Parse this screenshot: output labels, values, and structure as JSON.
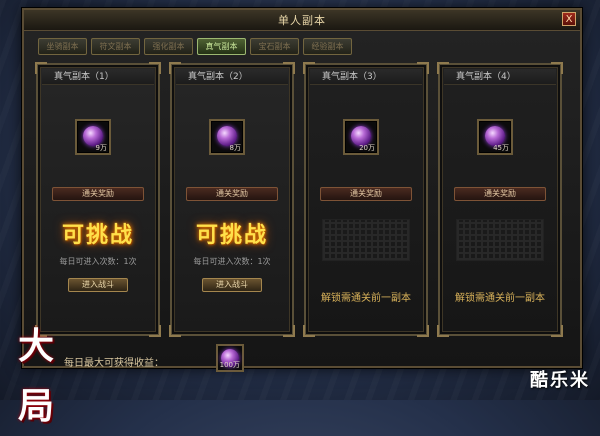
{
  "window": {
    "title": "单人副本",
    "close_label": "X"
  },
  "tabs": [
    {
      "label": "坐骑副本",
      "active": false
    },
    {
      "label": "符文副本",
      "active": false
    },
    {
      "label": "强化副本",
      "active": false
    },
    {
      "label": "真气副本",
      "active": true
    },
    {
      "label": "宝石副本",
      "active": false
    },
    {
      "label": "经验副本",
      "active": false
    }
  ],
  "dungeons": [
    {
      "name": "真气副本（1）",
      "reward_qty": "9万",
      "reward_button": "通关奖励",
      "status": "可挑战",
      "daily_text": "每日可进入次数：1次",
      "enter_button": "进入战斗"
    },
    {
      "name": "真气副本（2）",
      "reward_qty": "8万",
      "reward_button": "通关奖励",
      "status": "可挑战",
      "daily_text": "每日可进入次数：1次",
      "enter_button": "进入战斗"
    },
    {
      "name": "真气副本（3）",
      "reward_qty": "20万",
      "reward_button": "通关奖励",
      "locked_text": "解锁需通关前一副本"
    },
    {
      "name": "真气副本（4）",
      "reward_qty": "45万",
      "reward_button": "通关奖励",
      "locked_text": "解锁需通关前一副本"
    }
  ],
  "footer": {
    "label": "每日最大可获得收益：",
    "reward_qty": "100万"
  },
  "logo_text": "大局",
  "watermark": "酷乐米",
  "colors": {
    "accent_gold": "#ffe04a",
    "tab_active": "#c9e79a",
    "frame": "#5a4c34"
  },
  "icons": {
    "reward": "purple-orb-icon",
    "close": "close-icon"
  }
}
